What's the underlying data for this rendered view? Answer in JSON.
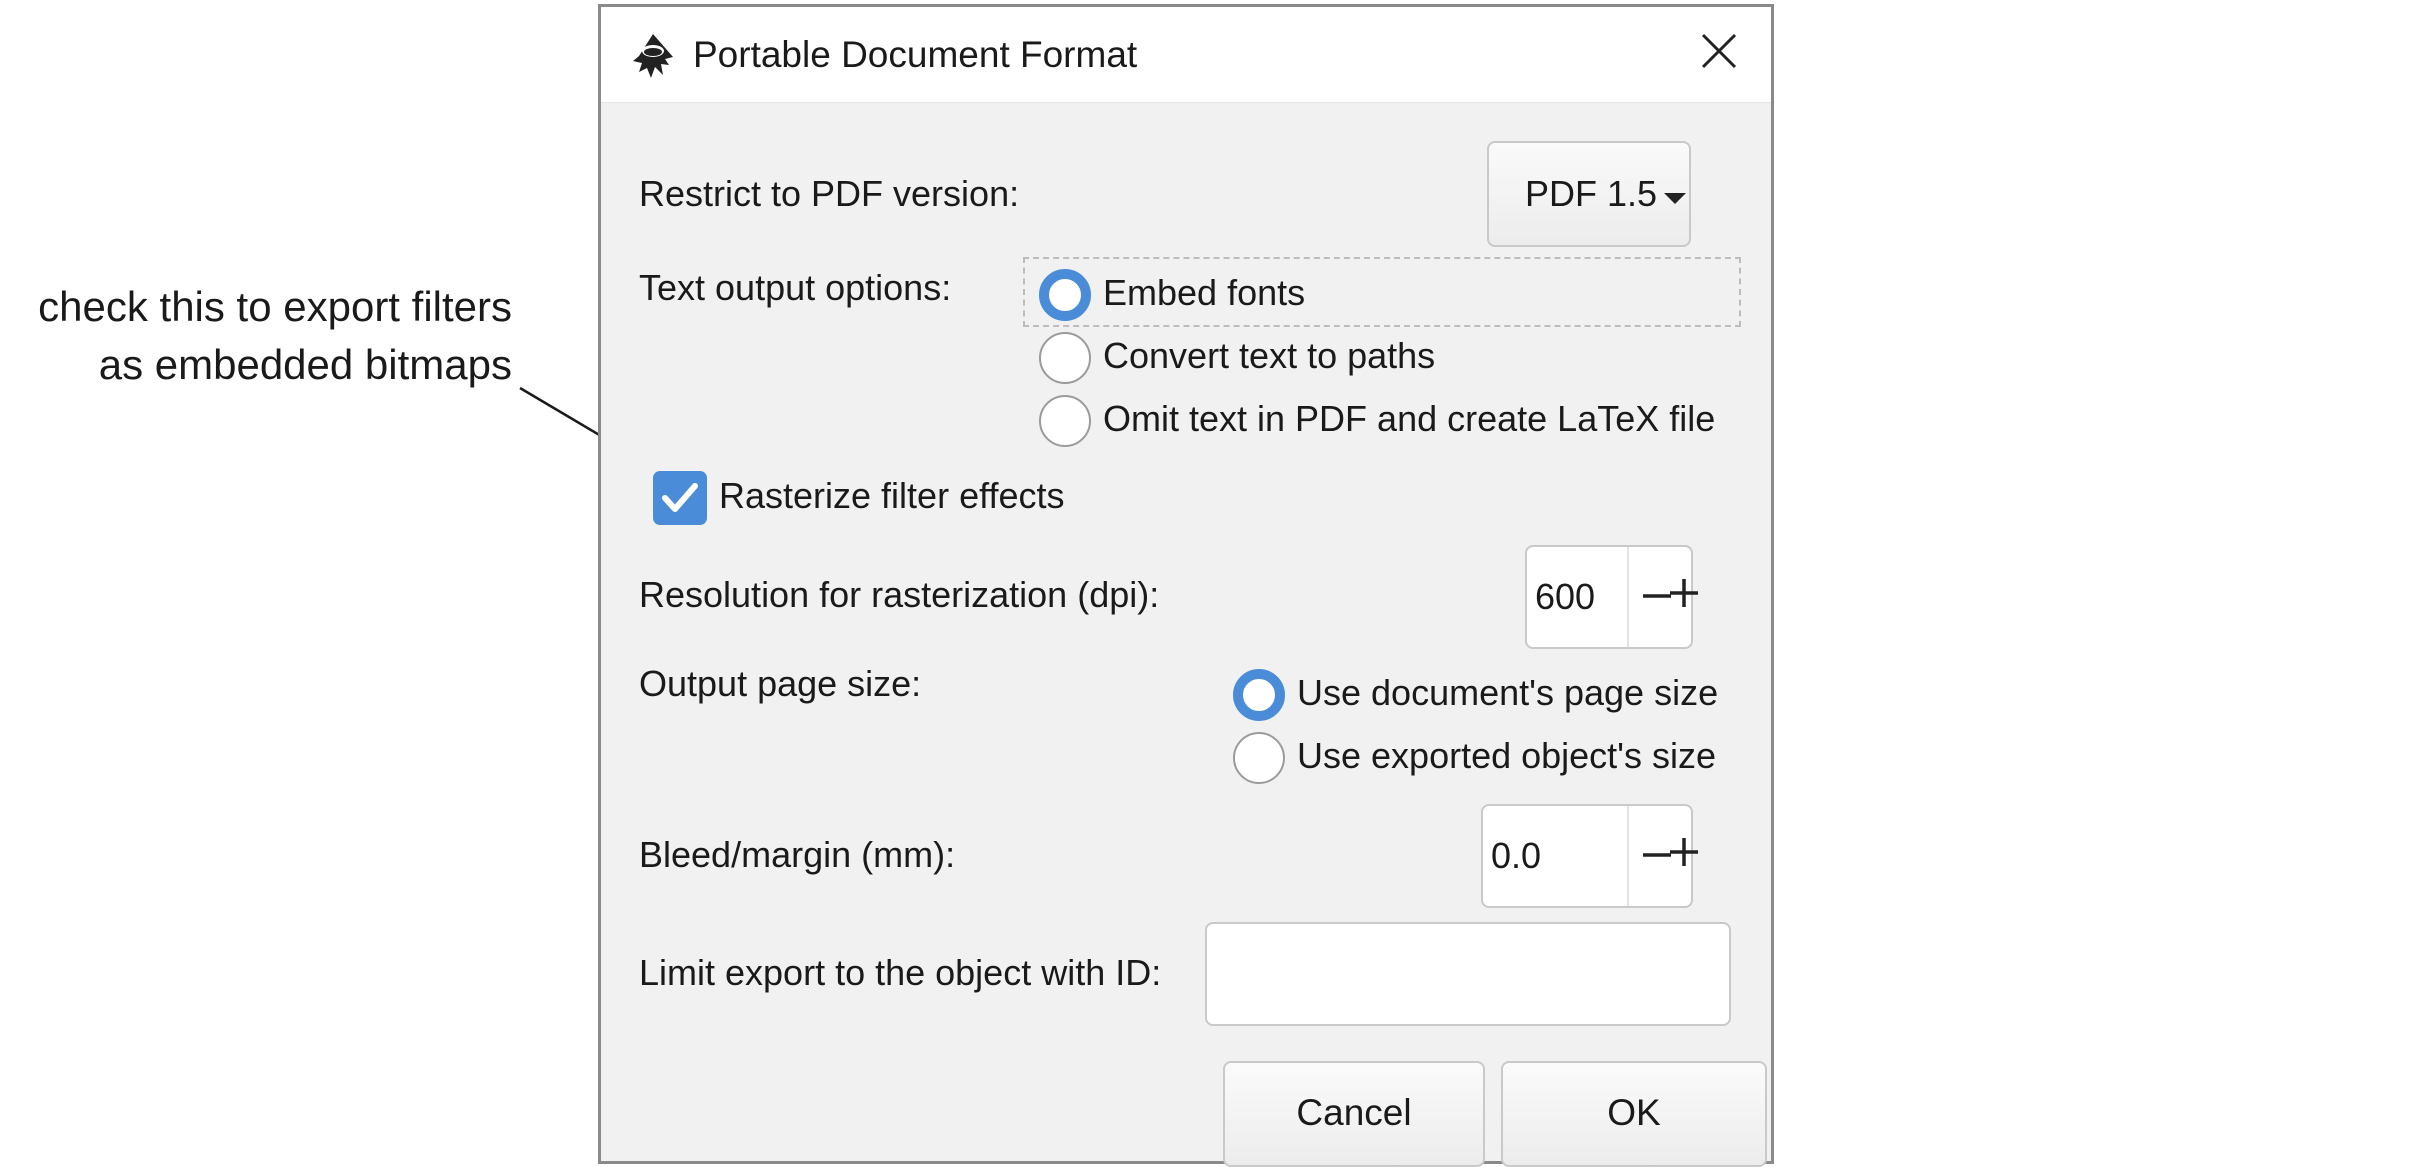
{
  "annotation": {
    "line1": "check this to export filters",
    "line2": "as embedded bitmaps"
  },
  "dialog": {
    "title": "Portable Document Format",
    "app_icon": "inkscape-logo-icon",
    "close_icon": "close-icon"
  },
  "version": {
    "label": "Restrict to PDF version:",
    "value": "PDF 1.5"
  },
  "text_output": {
    "label": "Text output options:",
    "options": [
      "Embed fonts",
      "Convert text to paths",
      "Omit text in PDF and create LaTeX file"
    ],
    "selected": 0
  },
  "rasterize": {
    "label": "Rasterize filter effects",
    "checked": true
  },
  "resolution": {
    "label": "Resolution for rasterization (dpi):",
    "value": "600"
  },
  "page_size": {
    "label": "Output page size:",
    "options": [
      "Use document's page size",
      "Use exported object's size"
    ],
    "selected": 0
  },
  "bleed": {
    "label": "Bleed/margin (mm):",
    "value": "0.0"
  },
  "limit_export": {
    "label": "Limit export to the object with ID:",
    "value": ""
  },
  "buttons": {
    "cancel": "Cancel",
    "ok": "OK"
  },
  "colors": {
    "accent": "#4a8cd8"
  }
}
